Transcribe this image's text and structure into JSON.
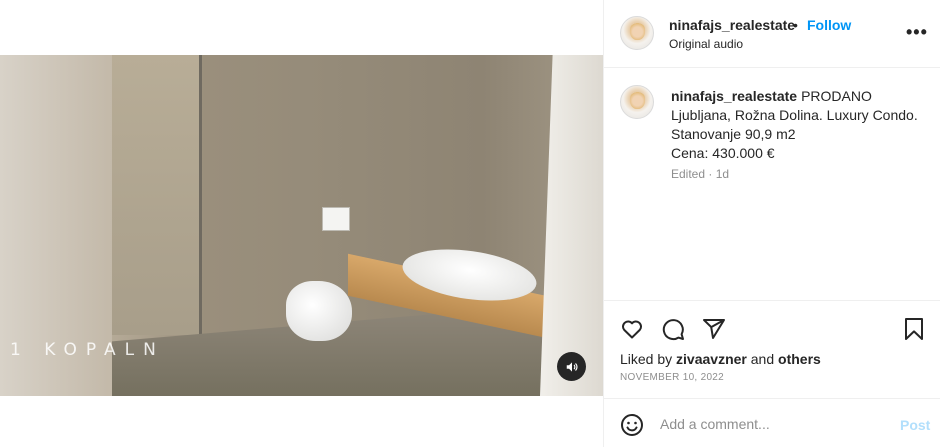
{
  "video": {
    "overlay_caption": "1 KOPALN",
    "mute_icon": "speaker-icon"
  },
  "header": {
    "username": "ninafajs_realestate",
    "separator": "•",
    "follow_label": "Follow",
    "audio_label": "Original audio",
    "more_label": "•••"
  },
  "caption": {
    "username": "ninafajs_realestate",
    "lines": [
      "PRODANO",
      "Ljubljana, Rožna Dolina. Luxury Condo.",
      "Stanovanje 90,9 m2",
      "Cena: 430.000 €"
    ],
    "meta": "Edited · 1d"
  },
  "actions": {
    "icons": [
      "heart-icon",
      "comment-icon",
      "share-icon",
      "bookmark-icon"
    ],
    "liked_by_prefix": "Liked by",
    "liked_by_user": "zivaavzner",
    "liked_by_and": "and",
    "liked_by_others": "others",
    "date": "NOVEMBER 10, 2022"
  },
  "comment": {
    "placeholder": "Add a comment...",
    "post_label": "Post",
    "emoji_icon": "emoji-icon"
  },
  "colors": {
    "follow": "#0095f6",
    "post_disabled": "#b2dffc",
    "muted_text": "#8e8e8e",
    "divider": "#efefef"
  }
}
